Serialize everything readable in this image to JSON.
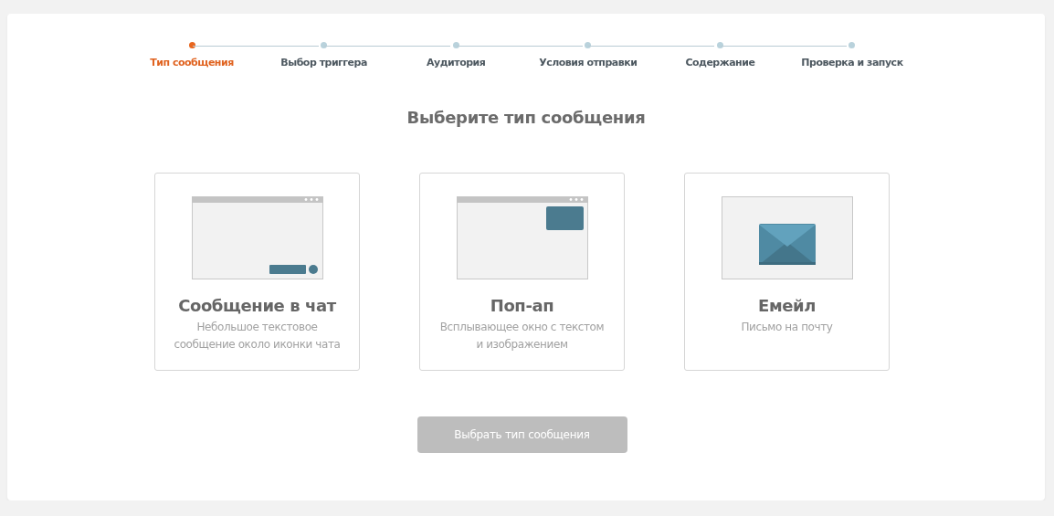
{
  "steps": [
    {
      "label": "Тип сообщения",
      "selected": true
    },
    {
      "label": "Выбор триггера",
      "selected": false
    },
    {
      "label": "Аудитория",
      "selected": false
    },
    {
      "label": "Условия отправки",
      "selected": false
    },
    {
      "label": "Содержание",
      "selected": false
    },
    {
      "label": "Проверка и запуск",
      "selected": false
    }
  ],
  "heading": "Выберите тип сообщения",
  "options": [
    {
      "kind": "chat",
      "title": "Сообщение в чат",
      "description": "Небольшое текстовое сообщение около иконки чата",
      "selected": false
    },
    {
      "kind": "popup",
      "title": "Поп-ап",
      "description": "Всплывающее окно с текстом и изображением",
      "selected": false
    },
    {
      "kind": "email",
      "title": "Емейл",
      "description": "Письмо на почту",
      "selected": false
    }
  ],
  "submit_button": {
    "label": "Выбрать тип сообщения",
    "disabled": true
  }
}
